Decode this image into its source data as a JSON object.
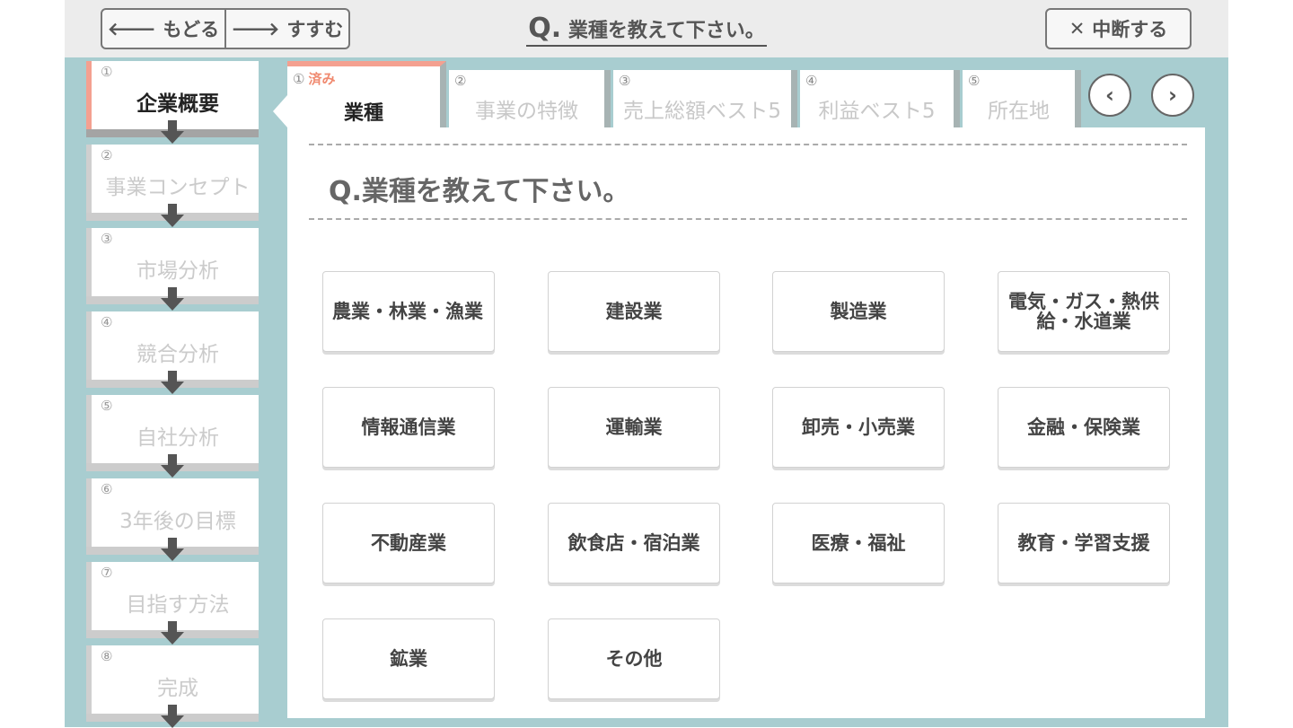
{
  "header": {
    "back_label": "もどる",
    "next_label": "すすむ",
    "title_q": "Q.",
    "title_text": "業種を教えて下さい。",
    "quit_label": "中断する",
    "icons": {
      "back": "arrow-left-icon",
      "next": "arrow-right-icon",
      "quit": "close-icon"
    }
  },
  "sidebar": {
    "items": [
      {
        "num": "①",
        "label": "企業概要",
        "state": "active"
      },
      {
        "num": "②",
        "label": "事業コンセプト",
        "state": "disabled"
      },
      {
        "num": "③",
        "label": "市場分析",
        "state": "disabled"
      },
      {
        "num": "④",
        "label": "競合分析",
        "state": "disabled"
      },
      {
        "num": "⑤",
        "label": "自社分析",
        "state": "disabled"
      },
      {
        "num": "⑥",
        "label": "3年後の目標",
        "state": "disabled"
      },
      {
        "num": "⑦",
        "label": "目指す方法",
        "state": "disabled"
      },
      {
        "num": "⑧",
        "label": "完成",
        "state": "disabled"
      }
    ]
  },
  "tabs": [
    {
      "num": "①",
      "done": "済み",
      "label": "業種",
      "state": "active"
    },
    {
      "num": "②",
      "label": "事業の特徴",
      "state": "disabled"
    },
    {
      "num": "③",
      "label": "売上総額ベスト5",
      "state": "disabled"
    },
    {
      "num": "④",
      "label": "利益ベスト5",
      "state": "disabled"
    },
    {
      "num": "⑤",
      "label": "所在地",
      "state": "disabled"
    }
  ],
  "tab_nav": {
    "prev": "‹",
    "next": "›"
  },
  "question": {
    "label": "Q.業種を教えて下さい。"
  },
  "options": [
    "農業・林業・漁業",
    "建設業",
    "製造業",
    "電気・ガス・熱供給・水道業",
    "情報通信業",
    "運輸業",
    "卸売・小売業",
    "金融・保険業",
    "不動産業",
    "飲食店・宿泊業",
    "医療・福祉",
    "教育・学習支援",
    "鉱業",
    "その他"
  ],
  "colors": {
    "accent": "#f4a090",
    "frame": "#a8cdd0",
    "done_text": "#f08a70"
  }
}
